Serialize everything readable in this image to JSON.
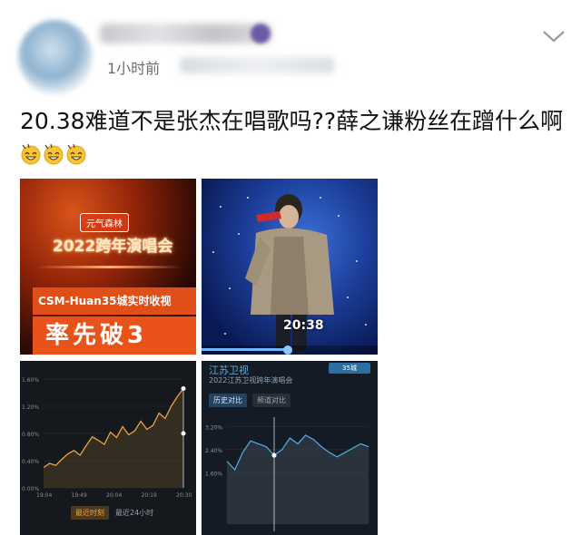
{
  "post": {
    "timestamp": "1小时前",
    "text": "20.38难道不是张杰在唱歌吗??薛之谦粉丝在蹭什么啊",
    "emoji_count": 3,
    "emoji_icon": "grinning-sweat-face-emoji"
  },
  "images": [
    {
      "badge": "元气森林",
      "title": "2022跨年演唱会",
      "banner": "CSM-Huan35城实时收视",
      "big_text": "率先破3"
    },
    {
      "time_overlay": "20:38",
      "progress": 0.49
    },
    {
      "buttons": [
        "最近时刻",
        "最近24小时"
      ]
    },
    {
      "title": "江苏卫视",
      "subtitle": "2022江苏卫视跨年演唱会",
      "badge": "35城",
      "buttons": [
        "历史对比",
        "频道对比"
      ]
    }
  ],
  "colors": {
    "chart1_line": "#f0a040",
    "chart2_line": "#4ba8e0",
    "accent_orange": "#e9531a"
  },
  "chart_data": [
    {
      "type": "line",
      "x_ticks": [
        "19:04",
        "19:49",
        "20:04",
        "20:19",
        "20:30"
      ],
      "y_ticks": [
        "0.00%",
        "0.40%",
        "0.80%",
        "1.20%",
        "1.60%"
      ],
      "ylim": [
        0,
        1.6
      ],
      "series": [
        {
          "values": [
            0.3,
            0.36,
            0.33,
            0.42,
            0.5,
            0.55,
            0.48,
            0.62,
            0.75,
            0.7,
            0.64,
            0.82,
            0.74,
            0.9,
            0.78,
            0.84,
            0.98,
            0.86,
            0.92,
            1.1,
            1.02,
            1.2,
            1.34,
            1.46
          ]
        }
      ]
    },
    {
      "type": "line",
      "y_ticks": [
        "1.60%",
        "2.40%",
        "3.20%"
      ],
      "ylim": [
        1.2,
        3.4
      ],
      "series": [
        {
          "values": [
            2.0,
            1.7,
            2.3,
            2.7,
            2.6,
            2.5,
            2.2,
            2.4,
            2.8,
            2.6,
            2.9,
            2.75,
            2.5,
            2.3,
            2.15,
            2.3,
            2.45,
            2.6,
            2.5
          ]
        }
      ]
    }
  ]
}
